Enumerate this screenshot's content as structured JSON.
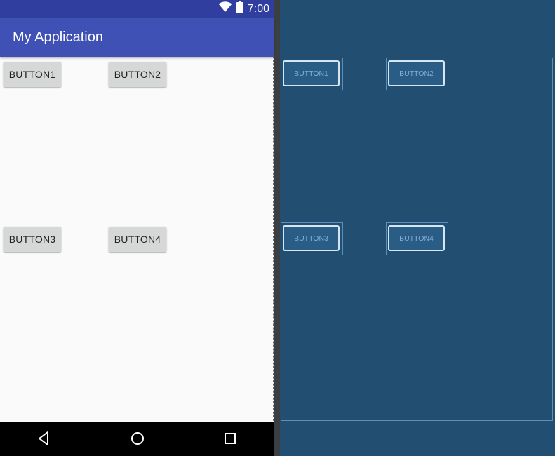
{
  "status_bar": {
    "time": "7:00",
    "icons": [
      "wifi-icon",
      "battery-icon"
    ],
    "color": "#303f9f"
  },
  "app_bar": {
    "title": "My Application",
    "color": "#3f51b5"
  },
  "buttons": [
    {
      "label": "BUTTON1"
    },
    {
      "label": "BUTTON2"
    },
    {
      "label": "BUTTON3"
    },
    {
      "label": "BUTTON4"
    }
  ],
  "nav_bar": {
    "icons": [
      "back-icon",
      "home-icon",
      "recents-icon"
    ]
  },
  "blueprint": {
    "background": "#224e71",
    "buttons": [
      {
        "label": "BUTTON1"
      },
      {
        "label": "BUTTON2"
      },
      {
        "label": "BUTTON3"
      },
      {
        "label": "BUTTON4"
      }
    ]
  }
}
